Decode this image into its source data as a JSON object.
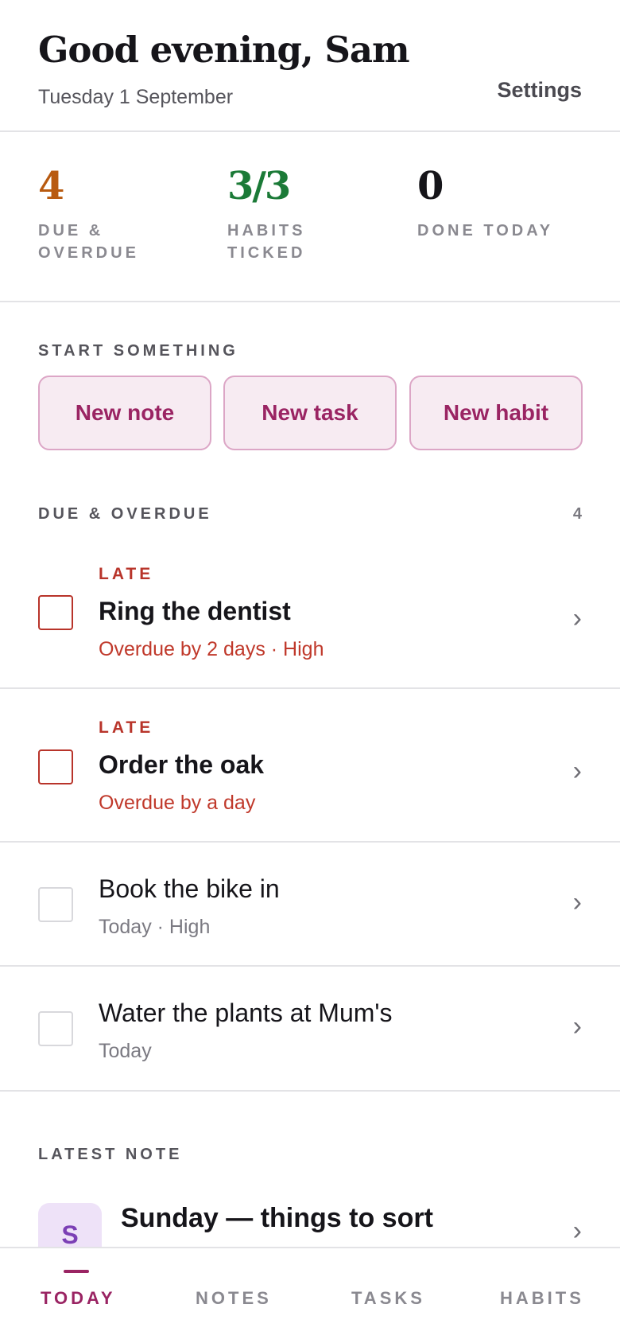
{
  "header": {
    "greeting": "Good evening, Sam",
    "date": "Tuesday 1 September",
    "settings_label": "Settings"
  },
  "stats": [
    {
      "value": "4",
      "label": "DUE & OVERDUE",
      "color": "#b85a10"
    },
    {
      "value": "3/3",
      "label": "HABITS TICKED",
      "color": "#1b7a37"
    },
    {
      "value": "0",
      "label": "DONE TODAY",
      "color": "#16151a"
    }
  ],
  "start": {
    "label": "START SOMETHING",
    "buttons": [
      "New note",
      "New task",
      "New habit"
    ]
  },
  "due": {
    "label": "DUE & OVERDUE",
    "count": "4",
    "tasks": [
      {
        "tag": "LATE",
        "title": "Ring the dentist",
        "meta": "Overdue by 2 days · High"
      },
      {
        "tag": "LATE",
        "title": "Order the oak",
        "meta": "Overdue by a day"
      },
      {
        "tag": "",
        "title": "Book the bike in",
        "meta": "Today · High"
      },
      {
        "tag": "",
        "title": "Water the plants at Mum's",
        "meta": "Today"
      }
    ]
  },
  "latest_note": {
    "label": "LATEST NOTE",
    "avatar": "S",
    "title": "Sunday — things to sort"
  },
  "tabs": [
    "TODAY",
    "NOTES",
    "TASKS",
    "HABITS"
  ],
  "colors": {
    "accent": "#9a2463",
    "late": "#b8342a"
  }
}
